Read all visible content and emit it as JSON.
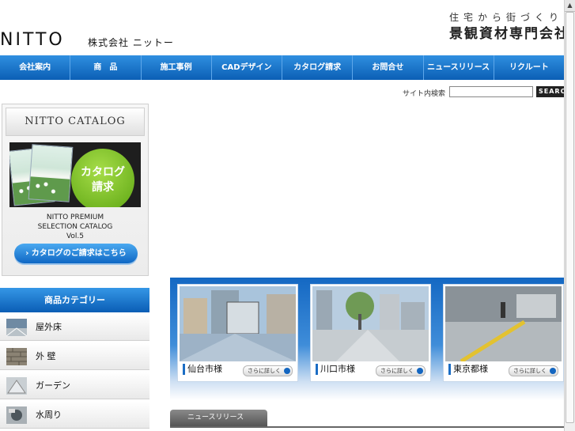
{
  "header": {
    "logo": "NITTO",
    "company": "株式会社 ニットー",
    "tagline_small": "住宅から街づくり",
    "tagline_big": "景観資材専門会社"
  },
  "nav": {
    "items": [
      "会社案内",
      "商　品",
      "施工事例",
      "CADデザイン",
      "カタログ請求",
      "お問合せ",
      "ニュースリリース",
      "リクルート"
    ]
  },
  "search": {
    "label": "サイト内検索",
    "value": "",
    "button": "SEARCH"
  },
  "catalog": {
    "title": "NITTO CATALOG",
    "circle_line1": "カタログ",
    "circle_line2": "請求",
    "text_line1": "NITTO PREMIUM",
    "text_line2": "SELECTION CATALOG",
    "text_line3": "Vol.5",
    "button": "カタログのご請求はこちら"
  },
  "category": {
    "title": "商品カテゴリー",
    "items": [
      {
        "label": "屋外床"
      },
      {
        "label": "外 壁"
      },
      {
        "label": "ガーデン"
      },
      {
        "label": "水周り"
      }
    ]
  },
  "cases": [
    {
      "label": "仙台市様",
      "more": "さらに詳しく"
    },
    {
      "label": "川口市様",
      "more": "さらに詳しく"
    },
    {
      "label": "東京都様",
      "more": "さらに詳しく"
    }
  ],
  "news": {
    "title": "ニュースリリース"
  },
  "colors": {
    "nav_blue": "#0b5fb5",
    "accent_green": "#5ca512"
  }
}
